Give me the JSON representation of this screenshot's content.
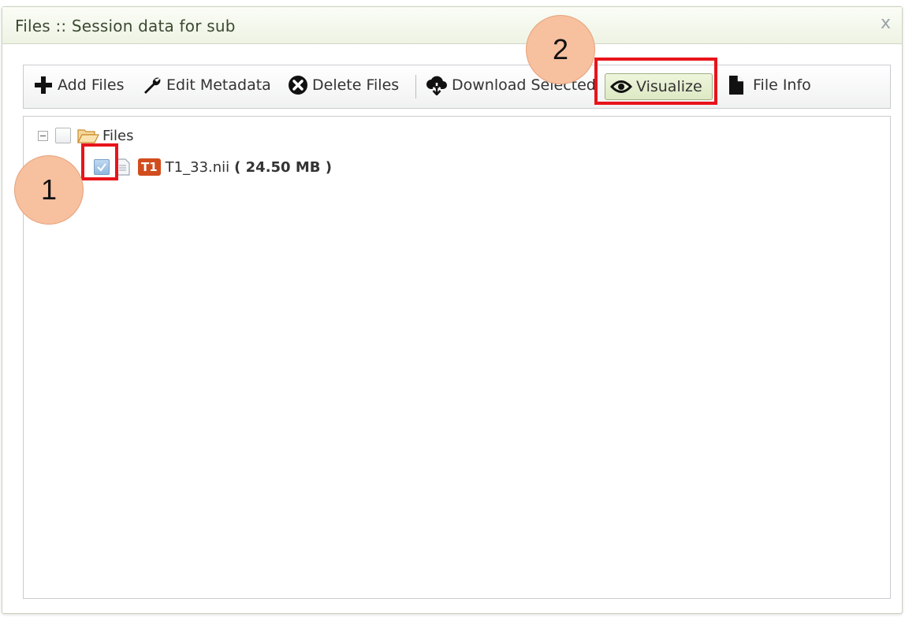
{
  "window": {
    "title": "Files :: Session data for sub",
    "close_glyph": "x"
  },
  "toolbar": {
    "add_files": "Add Files",
    "edit_metadata": "Edit Metadata",
    "delete_files": "Delete Files",
    "download_selected": "Download Selected",
    "visualize": "Visualize",
    "file_info": "File Info"
  },
  "tree": {
    "root_label": "Files",
    "files": [
      {
        "badge": "T1",
        "name": "T1_33.nii",
        "size": "( 24.50 MB )",
        "checked": true
      }
    ]
  },
  "annotations": {
    "step1": "1",
    "step2": "2",
    "highlight_color": "#e8141b",
    "callout_color": "#f7c09f"
  },
  "icons": {
    "add": "plus-icon",
    "edit": "wrench-icon",
    "delete": "x-circle-icon",
    "download": "cloud-download-icon",
    "visualize": "eye-icon",
    "info": "document-icon",
    "folder": "folder-open-icon",
    "file": "file-icon"
  }
}
